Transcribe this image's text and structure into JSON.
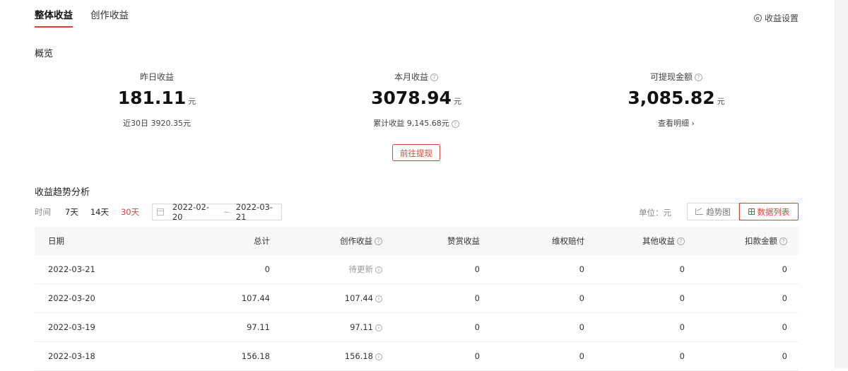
{
  "tabs": [
    {
      "label": "整体收益",
      "active": true
    },
    {
      "label": "创作收益",
      "active": false
    }
  ],
  "settings_label": "收益设置",
  "overview": {
    "title": "概览",
    "yesterday": {
      "label": "昨日收益",
      "value": "181.11",
      "unit": "元",
      "sub": "近30日 3920.35元"
    },
    "month": {
      "label": "本月收益",
      "value": "3078.94",
      "unit": "元",
      "sub": "累计收益 9,145.68元"
    },
    "withdrawable": {
      "label": "可提现金额",
      "value": "3,085.82",
      "unit": "元",
      "sub": "查看明细",
      "sub_arrow": "›"
    },
    "withdraw_button": "前往提现"
  },
  "trend": {
    "title": "收益趋势分析",
    "time_label": "时间",
    "ranges": [
      "7天",
      "14天",
      "30天"
    ],
    "active_range": "30天",
    "date_start": "2022-02-20",
    "date_sep": "~",
    "date_end": "2022-03-21",
    "unit_label": "单位：元",
    "view_trend": "趋势图",
    "view_list": "数据列表"
  },
  "table": {
    "headers": [
      "日期",
      "总计",
      "创作收益",
      "赞赏收益",
      "维权赔付",
      "其他收益",
      "扣款金额"
    ],
    "rows": [
      [
        "2022-03-21",
        "0",
        "待更新",
        "0",
        "0",
        "0",
        "0"
      ],
      [
        "2022-03-20",
        "107.44",
        "107.44",
        "0",
        "0",
        "0",
        "0"
      ],
      [
        "2022-03-19",
        "97.11",
        "97.11",
        "0",
        "0",
        "0",
        "0"
      ],
      [
        "2022-03-18",
        "156.18",
        "156.18",
        "0",
        "0",
        "0",
        "0"
      ]
    ]
  },
  "colors": {
    "accent": "#e33e33",
    "header_bg": "#f7f7f7",
    "border": "#eeeeee"
  }
}
